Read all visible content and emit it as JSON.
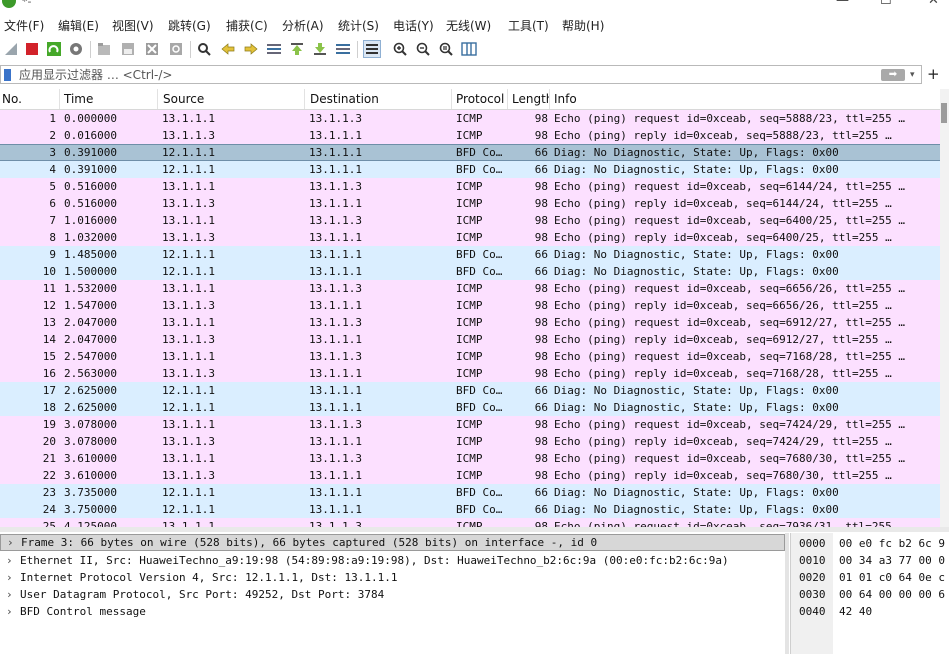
{
  "window": {
    "title": "*-",
    "min_glyph": "—",
    "max_glyph": "☐",
    "close_glyph": "✕"
  },
  "menu": [
    "文件(F)",
    "编辑(E)",
    "视图(V)",
    "跳转(G)",
    "捕获(C)",
    "分析(A)",
    "统计(S)",
    "电话(Y)",
    "无线(W)",
    "工具(T)",
    "帮助(H)"
  ],
  "toolbar_icons": [
    "shark-fin-start-icon",
    "stop-capture-icon",
    "restart-capture-icon",
    "capture-options-icon",
    "open-file-icon",
    "save-file-icon",
    "close-file-icon",
    "reload-file-icon",
    "find-packet-icon",
    "go-back-icon",
    "go-forward-icon",
    "go-to-packet-icon",
    "go-first-icon",
    "go-last-icon",
    "auto-scroll-icon",
    "colorize-icon",
    "zoom-in-icon",
    "zoom-out-icon",
    "zoom-reset-icon",
    "resize-columns-icon"
  ],
  "filter": {
    "placeholder": "应用显示过滤器 … <Ctrl-/>",
    "value": "",
    "apply_glyph": "➡",
    "dropdown_glyph": "▾",
    "add_glyph": "+"
  },
  "columns": [
    "No.",
    "Time",
    "Source",
    "Destination",
    "Protocol",
    "Length",
    "Info"
  ],
  "packets": [
    {
      "no": "1",
      "time": "0.000000",
      "src": "13.1.1.1",
      "dst": "13.1.1.3",
      "proto": "ICMP",
      "len": "98",
      "info": "Echo (ping) request  id=0xceab, seq=5888/23, ttl=255 …"
    },
    {
      "no": "2",
      "time": "0.016000",
      "src": "13.1.1.3",
      "dst": "13.1.1.1",
      "proto": "ICMP",
      "len": "98",
      "info": "Echo (ping) reply    id=0xceab, seq=5888/23, ttl=255 …"
    },
    {
      "no": "3",
      "time": "0.391000",
      "src": "12.1.1.1",
      "dst": "13.1.1.1",
      "proto": "BFD Co…",
      "len": "66",
      "info": "Diag: No Diagnostic, State: Up, Flags: 0x00"
    },
    {
      "no": "4",
      "time": "0.391000",
      "src": "12.1.1.1",
      "dst": "13.1.1.1",
      "proto": "BFD Co…",
      "len": "66",
      "info": "Diag: No Diagnostic, State: Up, Flags: 0x00"
    },
    {
      "no": "5",
      "time": "0.516000",
      "src": "13.1.1.1",
      "dst": "13.1.1.3",
      "proto": "ICMP",
      "len": "98",
      "info": "Echo (ping) request  id=0xceab, seq=6144/24, ttl=255 …"
    },
    {
      "no": "6",
      "time": "0.516000",
      "src": "13.1.1.3",
      "dst": "13.1.1.1",
      "proto": "ICMP",
      "len": "98",
      "info": "Echo (ping) reply    id=0xceab, seq=6144/24, ttl=255 …"
    },
    {
      "no": "7",
      "time": "1.016000",
      "src": "13.1.1.1",
      "dst": "13.1.1.3",
      "proto": "ICMP",
      "len": "98",
      "info": "Echo (ping) request  id=0xceab, seq=6400/25, ttl=255 …"
    },
    {
      "no": "8",
      "time": "1.032000",
      "src": "13.1.1.3",
      "dst": "13.1.1.1",
      "proto": "ICMP",
      "len": "98",
      "info": "Echo (ping) reply    id=0xceab, seq=6400/25, ttl=255 …"
    },
    {
      "no": "9",
      "time": "1.485000",
      "src": "12.1.1.1",
      "dst": "13.1.1.1",
      "proto": "BFD Co…",
      "len": "66",
      "info": "Diag: No Diagnostic, State: Up, Flags: 0x00"
    },
    {
      "no": "10",
      "time": "1.500000",
      "src": "12.1.1.1",
      "dst": "13.1.1.1",
      "proto": "BFD Co…",
      "len": "66",
      "info": "Diag: No Diagnostic, State: Up, Flags: 0x00"
    },
    {
      "no": "11",
      "time": "1.532000",
      "src": "13.1.1.1",
      "dst": "13.1.1.3",
      "proto": "ICMP",
      "len": "98",
      "info": "Echo (ping) request  id=0xceab, seq=6656/26, ttl=255 …"
    },
    {
      "no": "12",
      "time": "1.547000",
      "src": "13.1.1.3",
      "dst": "13.1.1.1",
      "proto": "ICMP",
      "len": "98",
      "info": "Echo (ping) reply    id=0xceab, seq=6656/26, ttl=255 …"
    },
    {
      "no": "13",
      "time": "2.047000",
      "src": "13.1.1.1",
      "dst": "13.1.1.3",
      "proto": "ICMP",
      "len": "98",
      "info": "Echo (ping) request  id=0xceab, seq=6912/27, ttl=255 …"
    },
    {
      "no": "14",
      "time": "2.047000",
      "src": "13.1.1.3",
      "dst": "13.1.1.1",
      "proto": "ICMP",
      "len": "98",
      "info": "Echo (ping) reply    id=0xceab, seq=6912/27, ttl=255 …"
    },
    {
      "no": "15",
      "time": "2.547000",
      "src": "13.1.1.1",
      "dst": "13.1.1.3",
      "proto": "ICMP",
      "len": "98",
      "info": "Echo (ping) request  id=0xceab, seq=7168/28, ttl=255 …"
    },
    {
      "no": "16",
      "time": "2.563000",
      "src": "13.1.1.3",
      "dst": "13.1.1.1",
      "proto": "ICMP",
      "len": "98",
      "info": "Echo (ping) reply    id=0xceab, seq=7168/28, ttl=255 …"
    },
    {
      "no": "17",
      "time": "2.625000",
      "src": "12.1.1.1",
      "dst": "13.1.1.1",
      "proto": "BFD Co…",
      "len": "66",
      "info": "Diag: No Diagnostic, State: Up, Flags: 0x00"
    },
    {
      "no": "18",
      "time": "2.625000",
      "src": "12.1.1.1",
      "dst": "13.1.1.1",
      "proto": "BFD Co…",
      "len": "66",
      "info": "Diag: No Diagnostic, State: Up, Flags: 0x00"
    },
    {
      "no": "19",
      "time": "3.078000",
      "src": "13.1.1.1",
      "dst": "13.1.1.3",
      "proto": "ICMP",
      "len": "98",
      "info": "Echo (ping) request  id=0xceab, seq=7424/29, ttl=255 …"
    },
    {
      "no": "20",
      "time": "3.078000",
      "src": "13.1.1.3",
      "dst": "13.1.1.1",
      "proto": "ICMP",
      "len": "98",
      "info": "Echo (ping) reply    id=0xceab, seq=7424/29, ttl=255 …"
    },
    {
      "no": "21",
      "time": "3.610000",
      "src": "13.1.1.1",
      "dst": "13.1.1.3",
      "proto": "ICMP",
      "len": "98",
      "info": "Echo (ping) request  id=0xceab, seq=7680/30, ttl=255 …"
    },
    {
      "no": "22",
      "time": "3.610000",
      "src": "13.1.1.3",
      "dst": "13.1.1.1",
      "proto": "ICMP",
      "len": "98",
      "info": "Echo (ping) reply    id=0xceab, seq=7680/30, ttl=255 …"
    },
    {
      "no": "23",
      "time": "3.735000",
      "src": "12.1.1.1",
      "dst": "13.1.1.1",
      "proto": "BFD Co…",
      "len": "66",
      "info": "Diag: No Diagnostic, State: Up, Flags: 0x00"
    },
    {
      "no": "24",
      "time": "3.750000",
      "src": "12.1.1.1",
      "dst": "13.1.1.1",
      "proto": "BFD Co…",
      "len": "66",
      "info": "Diag: No Diagnostic, State: Up, Flags: 0x00"
    },
    {
      "no": "25",
      "time": "4.125000",
      "src": "13.1.1.1",
      "dst": "13.1.1.3",
      "proto": "ICMP",
      "len": "98",
      "info": "Echo (ping) request  id=0xceab, seq=7936/31, ttl=255 …"
    }
  ],
  "selected_packet_no": "3",
  "colors": {
    "icmp_row": "#fce0ff",
    "bfd_row": "#daeeff",
    "selected_row": "#a9c2d4"
  },
  "details": [
    "Frame 3: 66 bytes on wire (528 bits), 66 bytes captured (528 bits) on interface -, id 0",
    "Ethernet II, Src: HuaweiTechno_a9:19:98 (54:89:98:a9:19:98), Dst: HuaweiTechno_b2:6c:9a (00:e0:fc:b2:6c:9a)",
    "Internet Protocol Version 4, Src: 12.1.1.1, Dst: 13.1.1.1",
    "User Datagram Protocol, Src Port: 49252, Dst Port: 3784",
    "BFD Control message"
  ],
  "details_chevron": "›",
  "bytes": [
    {
      "offset": "0000",
      "hex": "00 e0 fc b2 6c 9"
    },
    {
      "offset": "0010",
      "hex": "00 34 a3 77 00 0"
    },
    {
      "offset": "0020",
      "hex": "01 01 c0 64 0e c"
    },
    {
      "offset": "0030",
      "hex": "00 64 00 00 00 6"
    },
    {
      "offset": "0040",
      "hex": "42 40"
    }
  ]
}
